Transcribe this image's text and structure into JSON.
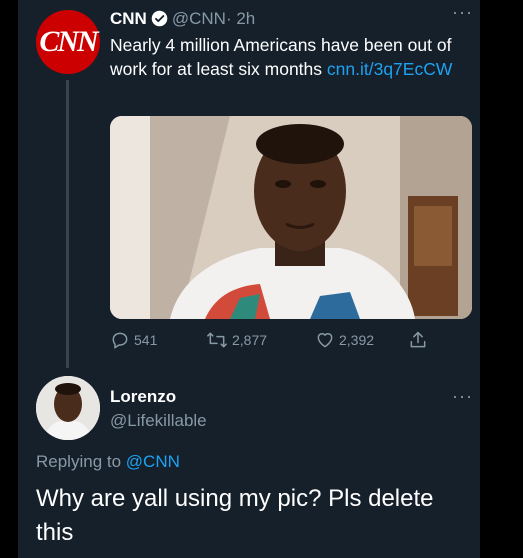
{
  "tweet": {
    "avatar_text": "CNN",
    "name": "CNN",
    "handle": "@CNN",
    "time": "· 2h",
    "more": "···",
    "text": "Nearly 4 million Americans have been out of work for at least six months ",
    "link": "cnn.it/3q7EcCW",
    "actions": {
      "replies": "541",
      "retweets": "2,877",
      "likes": "2,392"
    }
  },
  "reply": {
    "name": "Lorenzo",
    "handle": "@Lifekillable",
    "more": "···",
    "replying_prefix": "Replying to ",
    "replying_to": "@CNN",
    "text": "Why are yall using my pic? Pls delete this"
  },
  "colors": {
    "background": "#15202b",
    "accent": "#1da1f2",
    "secondary_text": "#8899a6",
    "cnn_red": "#cc0000"
  },
  "icons": [
    "verified-icon",
    "more-icon",
    "reply-icon",
    "retweet-icon",
    "like-icon",
    "share-icon"
  ]
}
